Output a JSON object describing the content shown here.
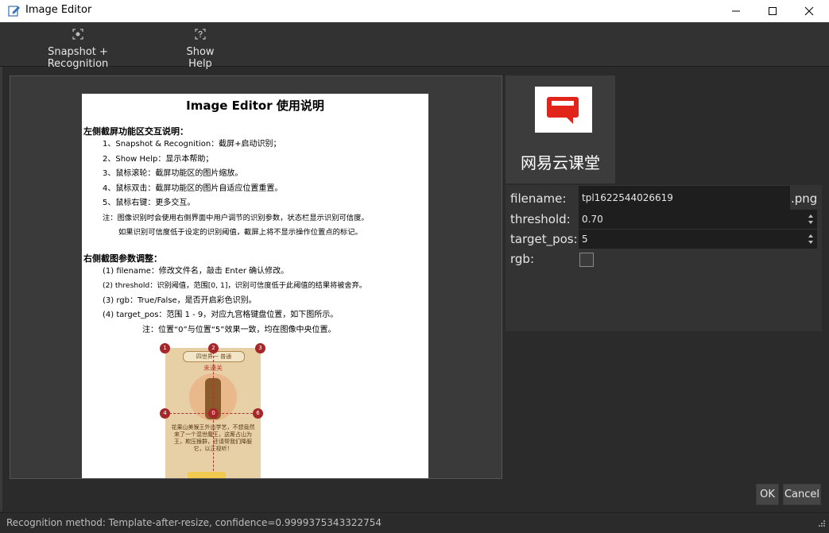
{
  "window": {
    "title": "Image Editor",
    "controls": [
      "minimize-icon",
      "maximize-icon",
      "close-icon"
    ]
  },
  "toolbar": {
    "snapshot_label": "Snapshot + Recognition",
    "help_label": "Show Help"
  },
  "doc": {
    "title": "Image Editor 使用说明",
    "left_heading": "左侧截屏功能区交互说明：",
    "left_lines": [
      "1、Snapshot & Recognition：截屏+启动识别；",
      "2、Show Help：显示本帮助；",
      "3、鼠标滚轮：截屏功能区的图片缩放。",
      "4、鼠标双击：截屏功能区的图片自适应位置重置。",
      "5、鼠标右键：更多交互。",
      "注：图像识别时会使用右侧界面中用户调节的识别参数，状态栏显示识别可信度。",
      "如果识别可信度低于设定的识别阈值，截屏上将不显示操作位置点的标记。"
    ],
    "right_heading": "右侧截图参数调整：",
    "right_lines": [
      "(1)  filename：修改文件名，敲击 Enter 确认修改。",
      "(2)  threshold：识别阈值，范围[0, 1]，识别可信度低于此阈值的结果将被舍弃。",
      "(3)  rgb：True/False，是否开启彩色识别。",
      "(4)  target_pos：范围 1 - 9，对应九宫格键盘位置，如下图所示。",
      "注：位置“0”与位置“5”效果一致，均在图像中央位置。"
    ],
    "game": {
      "header": "四世界一 普通",
      "status": "未通关",
      "caption": "花果山美猴王外出学艺，不想竟然来了一个混世魔王，这厮占山为王，欺压猴群，还请帮我们降服它，以正视听！",
      "markers": [
        "1",
        "2",
        "3",
        "4",
        "0",
        "6"
      ]
    }
  },
  "thumbnail": {
    "text": "网易云课堂",
    "accent": "#e1251b"
  },
  "params": {
    "filename_label": "filename:",
    "filename_value": "tpl1622544026619",
    "filename_ext": ".png",
    "threshold_label": "threshold:",
    "threshold_value": "0.70",
    "target_pos_label": "target_pos:",
    "target_pos_value": "5",
    "rgb_label": "rgb:",
    "rgb_checked": false
  },
  "buttons": {
    "ok": "OK",
    "cancel": "Cancel"
  },
  "status": {
    "text": "Recognition method: Template-after-resize, confidence=0.9999375343322754"
  }
}
